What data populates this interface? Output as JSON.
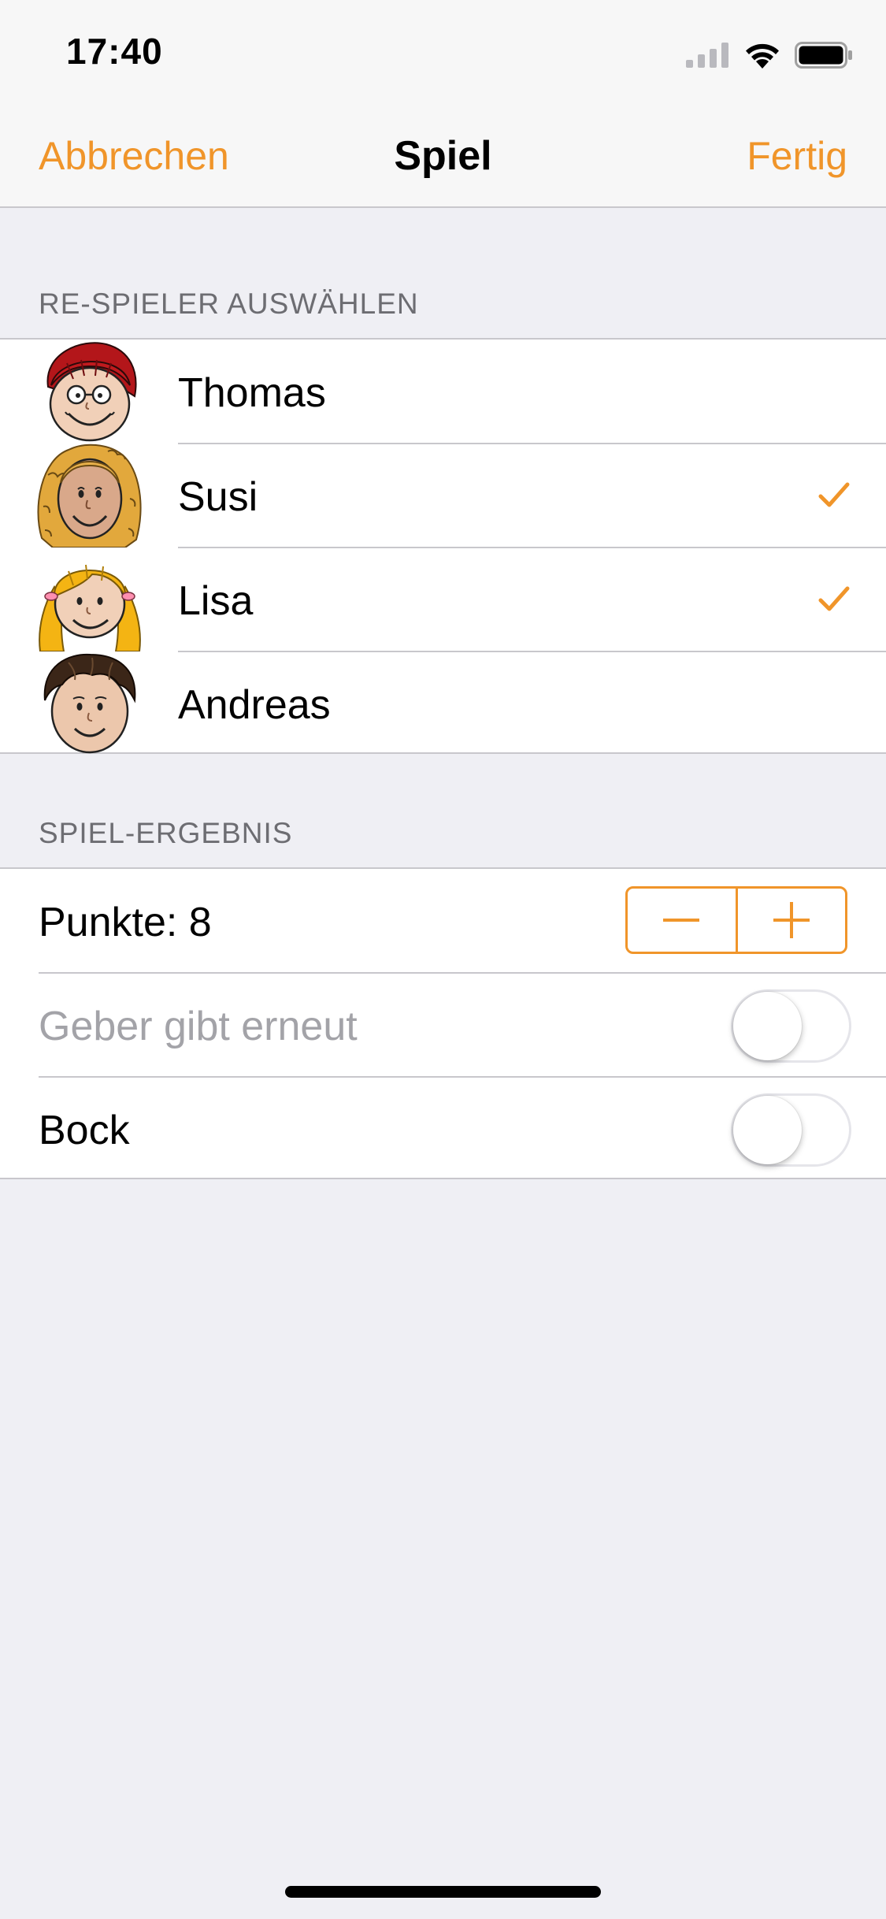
{
  "status_bar": {
    "time": "17:40",
    "signal_icon": "cellular-signal-icon",
    "wifi_icon": "wifi-icon",
    "battery_icon": "battery-icon"
  },
  "nav": {
    "cancel_label": "Abbrechen",
    "title": "Spiel",
    "done_label": "Fertig"
  },
  "sections": {
    "players_header": "RE-SPIELER AUSWÄHLEN",
    "result_header": "SPIEL-ERGEBNIS"
  },
  "players": [
    {
      "name": "Thomas",
      "selected": false,
      "hair_color": "#b3161a",
      "avatar": "avatar-red-hair-glasses"
    },
    {
      "name": "Susi",
      "selected": true,
      "hair_color": "#e2a83c",
      "avatar": "avatar-curly-blonde-hair"
    },
    {
      "name": "Lisa",
      "selected": true,
      "hair_color": "#f4b413",
      "avatar": "avatar-yellow-pigtails"
    },
    {
      "name": "Andreas",
      "selected": false,
      "hair_color": "#3b2618",
      "avatar": "avatar-dark-brown-hair"
    }
  ],
  "result": {
    "points_label": "Punkte: 8",
    "points_value": 8,
    "geber_label": "Geber gibt erneut",
    "geber_on": false,
    "geber_enabled": false,
    "bock_label": "Bock",
    "bock_on": false
  },
  "colors": {
    "accent": "#f0952a",
    "background": "#efeff4",
    "separator": "#c8c7cc",
    "section_header_text": "#6d6d72",
    "disabled_text": "#a3a3a8"
  }
}
